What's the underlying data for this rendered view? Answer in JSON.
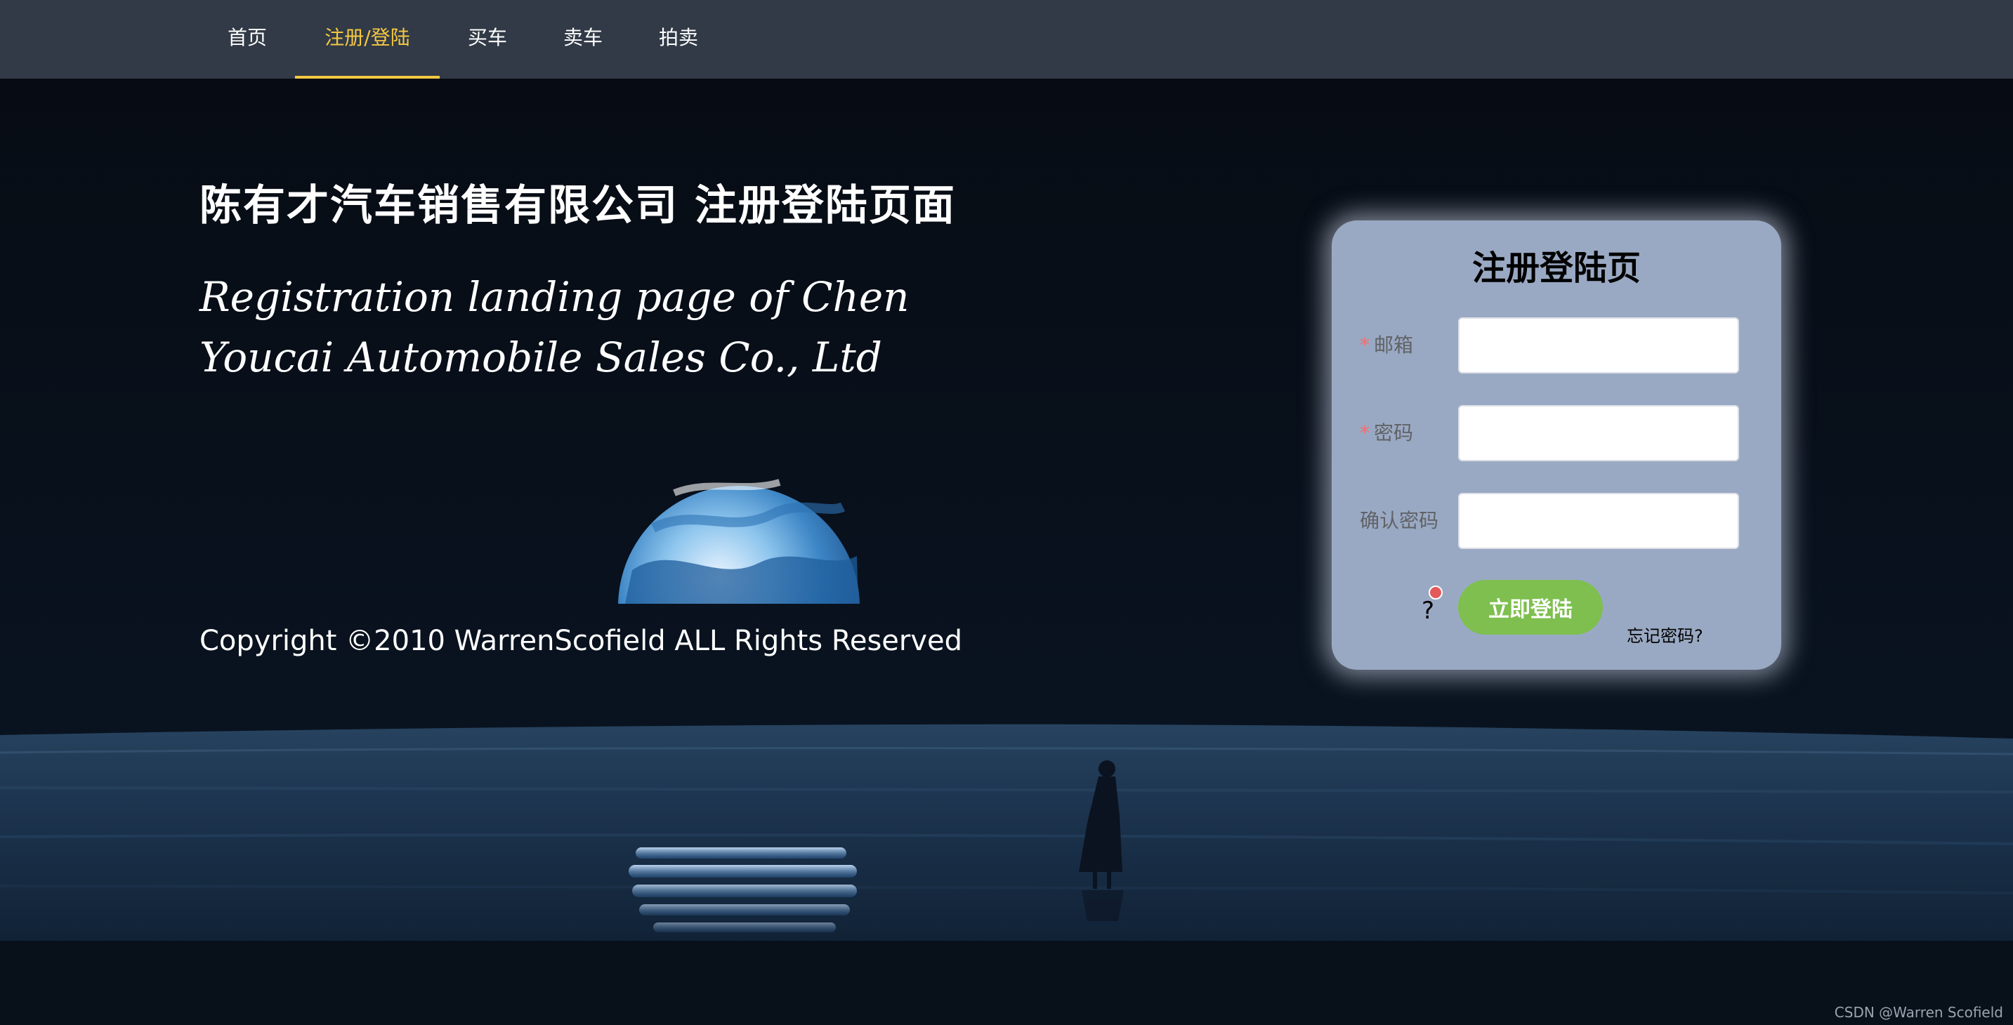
{
  "nav": {
    "items": [
      {
        "label": "首页"
      },
      {
        "label": "注册/登陆",
        "active": true
      },
      {
        "label": "买车"
      },
      {
        "label": "卖车"
      },
      {
        "label": "拍卖"
      }
    ]
  },
  "hero": {
    "title": "陈有才汽车销售有限公司 注册登陆页面",
    "subtitle": "Registration landing page of Chen Youcai Automobile Sales Co., Ltd",
    "copyright": "Copyright ©2010 WarrenScofield ALL Rights Reserved"
  },
  "login_card": {
    "title": "注册登陆页",
    "fields": {
      "email": {
        "label": "邮箱",
        "required": true,
        "value": ""
      },
      "password": {
        "label": "密码",
        "required": true,
        "value": ""
      },
      "confirm": {
        "label": "确认密码",
        "required": false,
        "value": ""
      }
    },
    "help_mark": "?",
    "login_button": "立即登陆",
    "forgot_link": "忘记密码?"
  },
  "watermark": "CSDN @Warren Scofield",
  "colors": {
    "nav_bg": "#313a46",
    "nav_active": "#f5c842",
    "card_bg": "#9aa9c3",
    "button_green": "#7ebf4f",
    "required_red": "#f56c6c",
    "page_bg": "#070c14"
  },
  "icons": {
    "planet": "planet-illustration",
    "figure": "standing-figure-silhouette"
  }
}
